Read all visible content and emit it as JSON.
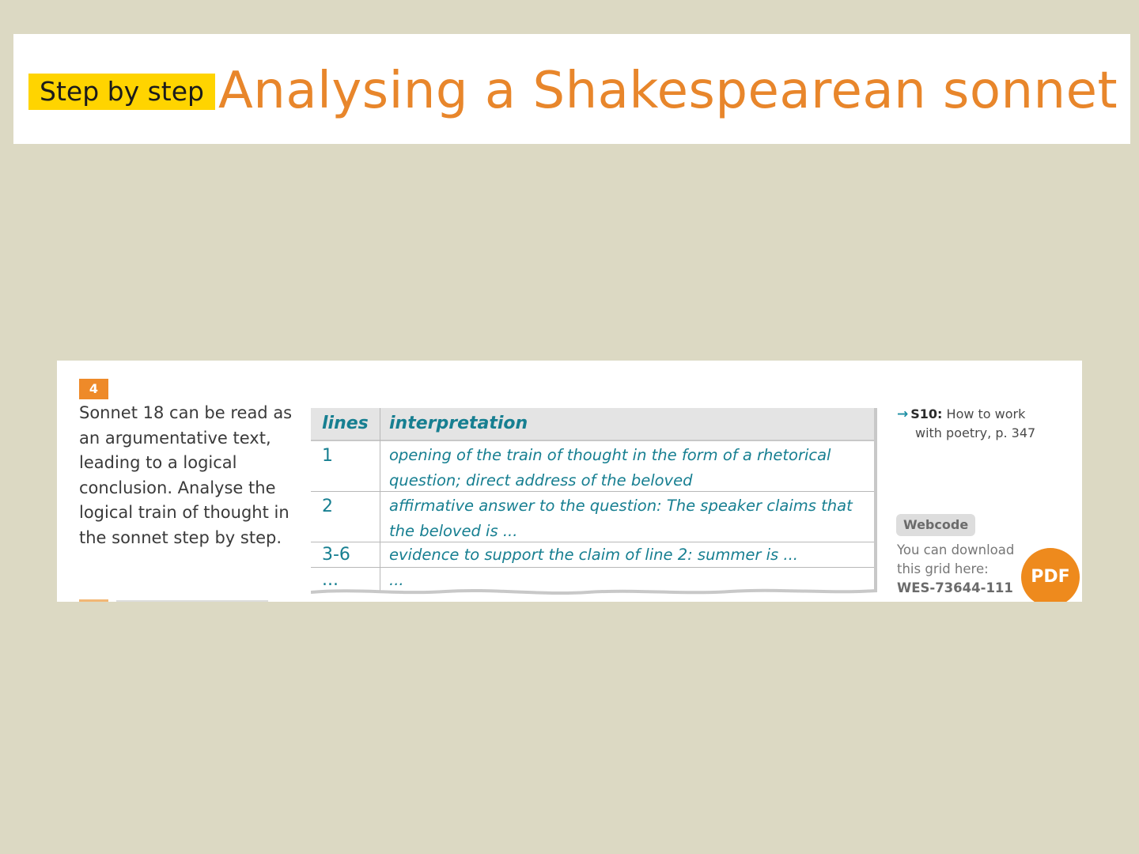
{
  "header": {
    "badge": "Step by step",
    "title": "Analysing a Shakespearean sonnet"
  },
  "task": {
    "number": "4",
    "text": "Sonnet 18 can be read as an argumentative text, leading to a logical conclusion. Analyse the logical train of thought in the sonnet step by step."
  },
  "grid": {
    "headers": {
      "lines": "lines",
      "interpretation": "interpretation"
    },
    "rows": [
      {
        "lines": "1",
        "interpretation": "opening of the train of thought in the form of a rhetorical question; direct address of the beloved"
      },
      {
        "lines": "2",
        "interpretation": "affirmative answer to the question: The speaker claims that the beloved is ..."
      },
      {
        "lines": "3-6",
        "interpretation": "evidence to support the claim of line 2: summer is ..."
      },
      {
        "lines": "...",
        "interpretation": "..."
      }
    ]
  },
  "crossref": {
    "arrow_icon": "arrow-right-icon",
    "code": "S10:",
    "text_line1": "How to work",
    "text_line2": "with poetry, p. 347"
  },
  "webcode": {
    "label": "Webcode",
    "download_line1": "You can download",
    "download_line2": "this grid here:",
    "code": "WES-73644-111",
    "pdf_label": "PDF"
  },
  "colors": {
    "background": "#dcd9c3",
    "title": "#e8862b",
    "badge": "#ffd400",
    "task_number": "#ee8a29",
    "table_text": "#177f91",
    "pdf": "#ee8a1d"
  }
}
